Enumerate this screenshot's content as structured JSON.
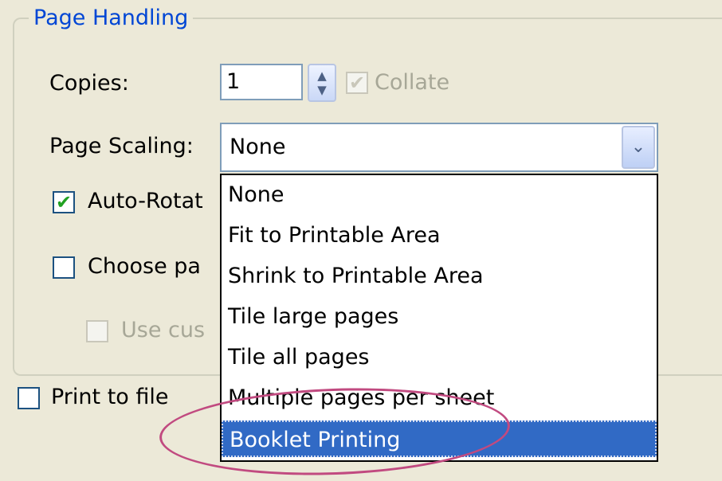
{
  "page_handling": {
    "title": "Page Handling",
    "copies_label": "Copies:",
    "copies_value": "1",
    "collate_label": "Collate",
    "page_scaling_label": "Page Scaling:",
    "page_scaling_value": "None",
    "auto_rotate_label": "Auto-Rotat",
    "choose_paper_label": "Choose pa",
    "use_custom_label": "Use cus"
  },
  "print_to_file_label": "Print to file",
  "dropdown_options": [
    "None",
    "Fit to Printable Area",
    "Shrink to Printable Area",
    "Tile large pages",
    "Tile all pages",
    "Multiple pages per sheet",
    "Booklet Printing"
  ],
  "selected_option": "Booklet Printing",
  "checkmark_glyph": "✔",
  "spinner_up": "▲",
  "spinner_down": "▼",
  "combo_arrow": "⌄",
  "colors": {
    "accent_title": "#0046d5",
    "selection_bg": "#316ac5",
    "annotation_ellipse": "#c14a80",
    "checkmark": "#21a121"
  }
}
